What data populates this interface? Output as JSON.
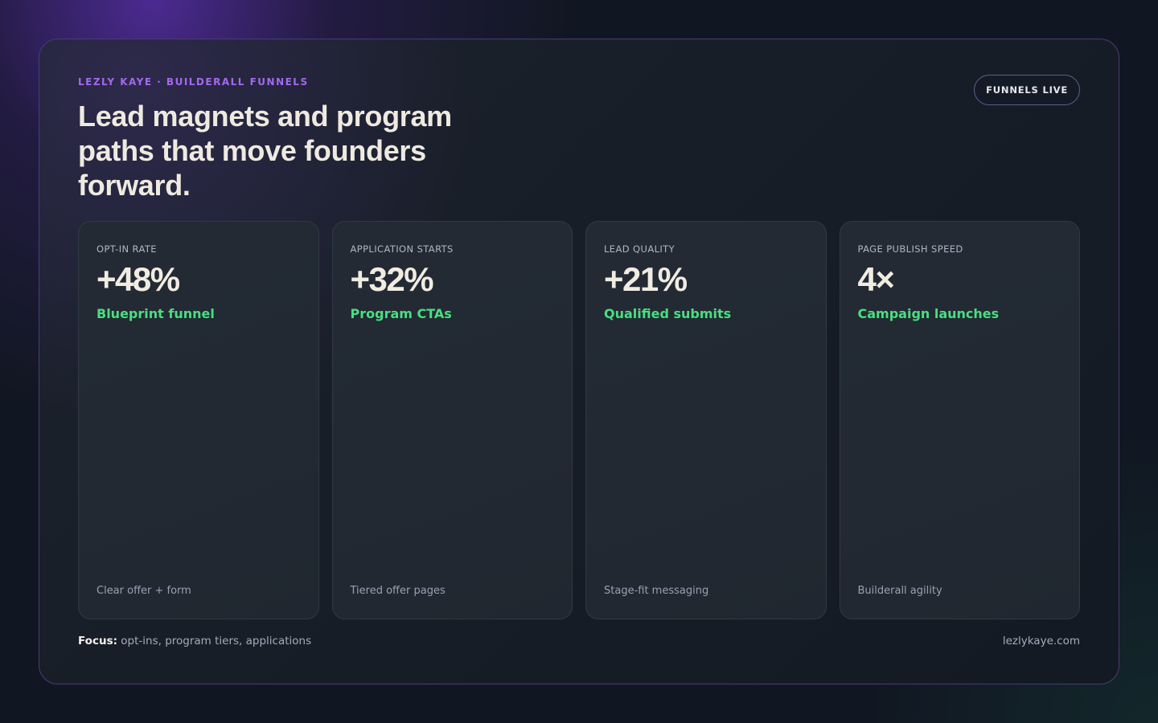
{
  "header": {
    "eyebrow": "LEZLY KAYE · BUILDERALL FUNNELS",
    "headline": "Lead magnets and program paths that move founders forward.",
    "badge": "FUNNELS LIVE"
  },
  "cards": [
    {
      "label": "OPT-IN RATE",
      "value": "+48%",
      "sub": "Blueprint funnel",
      "note": "Clear offer + form"
    },
    {
      "label": "APPLICATION STARTS",
      "value": "+32%",
      "sub": "Program CTAs",
      "note": "Tiered offer pages"
    },
    {
      "label": "LEAD QUALITY",
      "value": "+21%",
      "sub": "Qualified submits",
      "note": "Stage-fit messaging"
    },
    {
      "label": "PAGE PUBLISH SPEED",
      "value": "4×",
      "sub": "Campaign launches",
      "note": "Builderall agility"
    }
  ],
  "footer": {
    "focus_label": "Focus:",
    "focus_text": " opt-ins, program tiers, applications",
    "site": "lezlykaye.com"
  },
  "colors": {
    "accent_purple": "#a468f0",
    "accent_green": "#4ade80",
    "background": "#111722"
  }
}
